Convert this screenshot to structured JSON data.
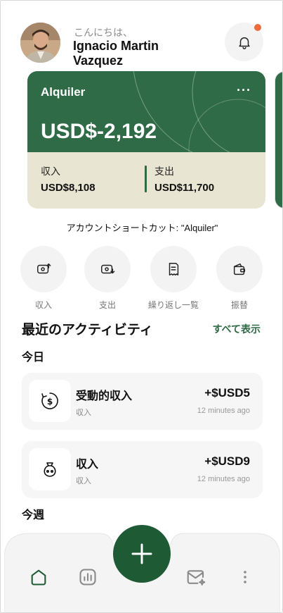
{
  "header": {
    "greeting": "こんにちは、",
    "user_name": "Ignacio Martin Vazquez"
  },
  "account_card": {
    "title": "Alquiler",
    "balance": "USD$-2,192",
    "income_label": "収入",
    "income_value": "USD$8,108",
    "expense_label": "支出",
    "expense_value": "USD$11,700",
    "more": "···"
  },
  "shortcut_caption": "アカウントショートカット: \"Alquiler\"",
  "quick_actions": [
    {
      "label": "収入",
      "icon": "income-icon"
    },
    {
      "label": "支出",
      "icon": "expense-icon"
    },
    {
      "label": "繰り返し一覧",
      "icon": "recurring-list-icon"
    },
    {
      "label": "振替",
      "icon": "transfer-wallet-icon"
    }
  ],
  "activity": {
    "title": "最近のアクティビティ",
    "see_all": "すべて表示",
    "today_label": "今日",
    "week_label": "今週",
    "items": [
      {
        "name": "受動的収入",
        "category": "収入",
        "amount": "+$USD5",
        "time": "12 minutes ago",
        "icon": "passive-income-icon"
      },
      {
        "name": "収入",
        "category": "収入",
        "amount": "+$USD9",
        "time": "12 minutes ago",
        "icon": "money-bag-icon"
      }
    ]
  },
  "nav": {
    "items": [
      "home-icon",
      "stats-icon",
      "add-icon",
      "messages-icon",
      "more-vertical-icon"
    ]
  },
  "colors": {
    "brand_green": "#2f6b47",
    "fab_green": "#1e5a33",
    "card_bottom": "#e8e5d2",
    "notification_dot": "#ee6b3b"
  }
}
